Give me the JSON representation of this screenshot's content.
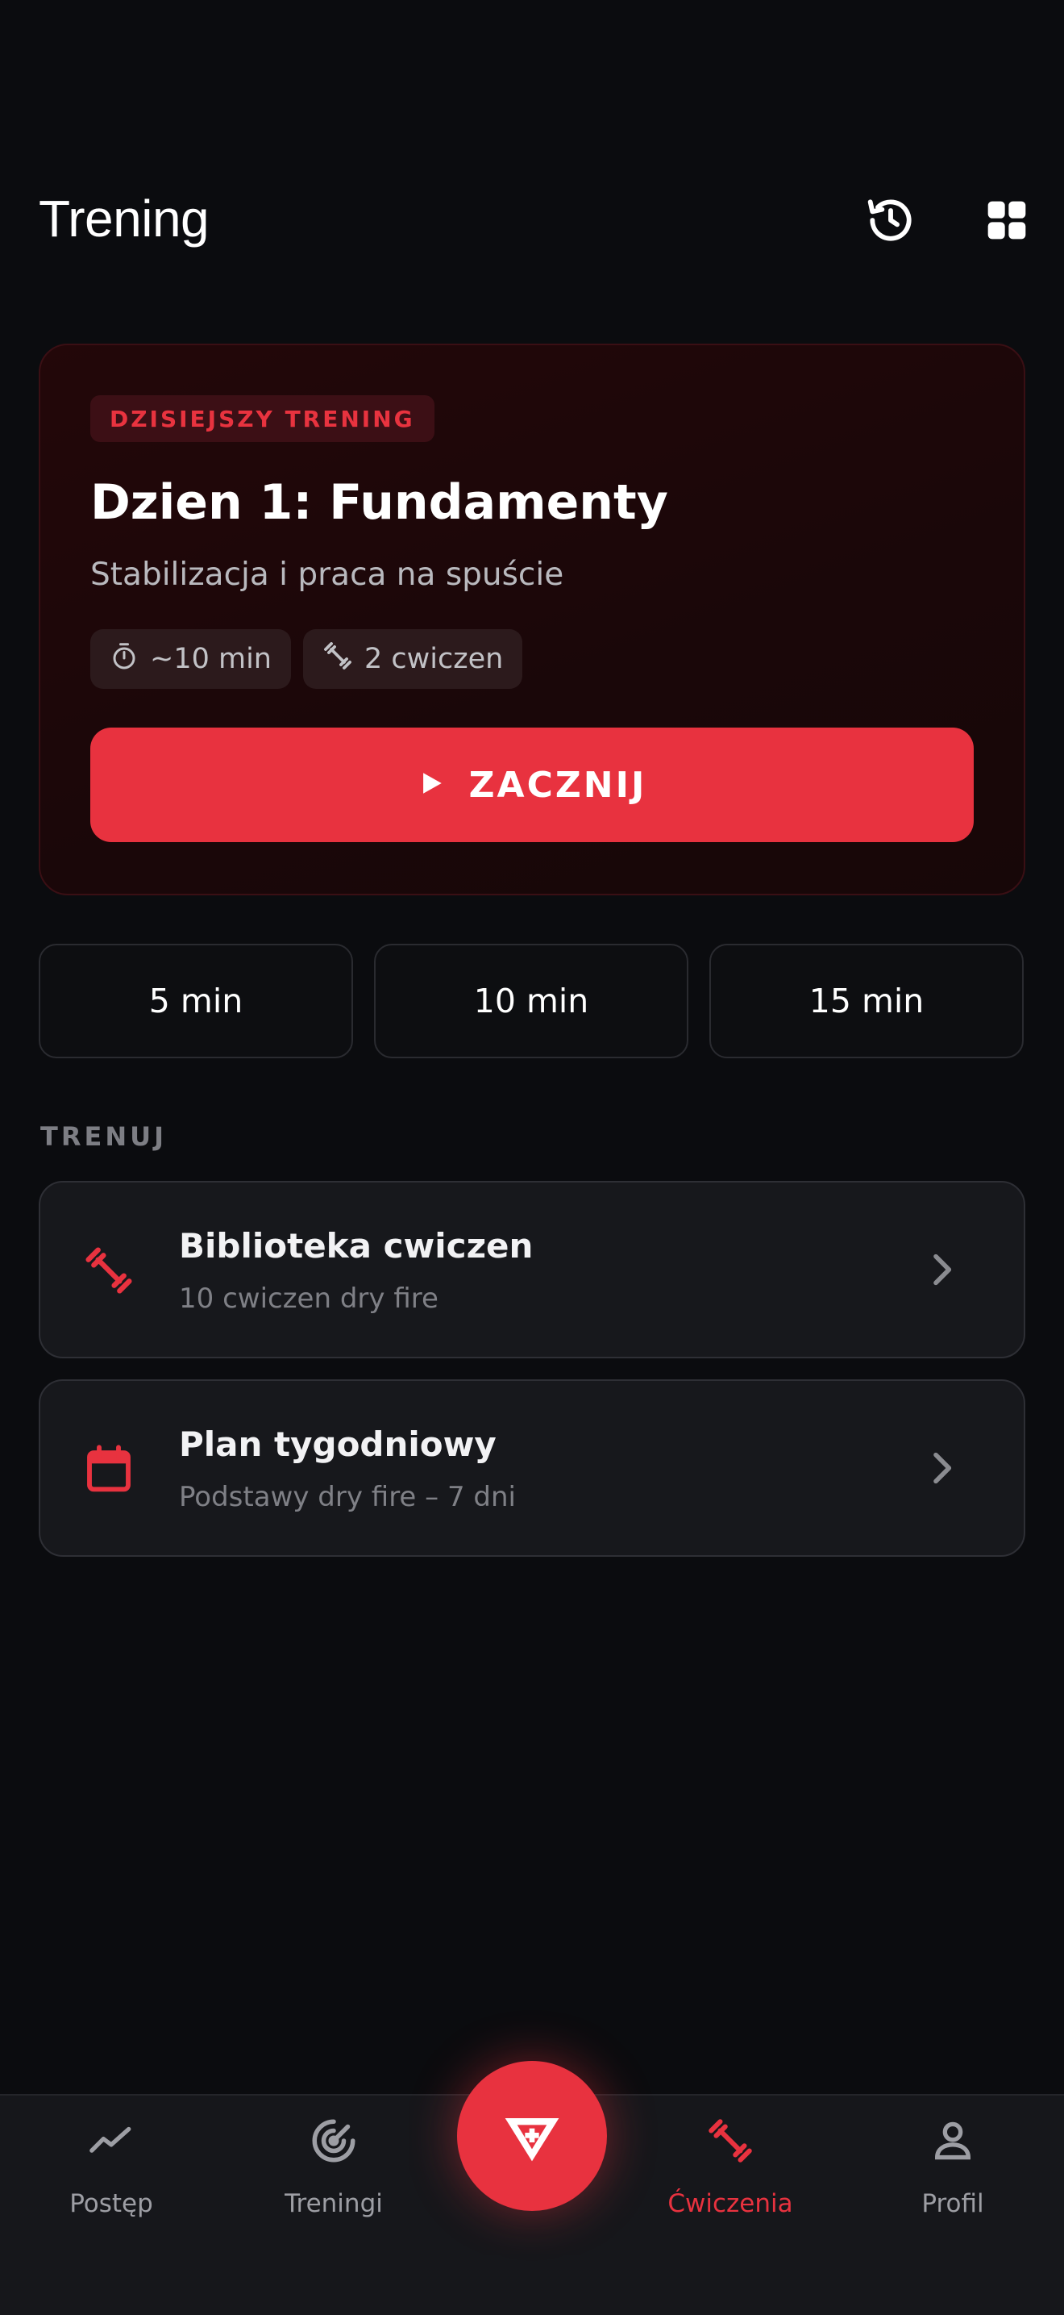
{
  "header": {
    "title": "Trening",
    "icons": [
      "history-icon",
      "grid-icon"
    ]
  },
  "today_card": {
    "tag": "DZISIEJSZY TRENING",
    "title": "Dzien 1: Fundamenty",
    "subtitle": "Stabilizacja i praca na spuście",
    "duration": "~10 min",
    "exercises": "2 cwiczen",
    "start_label": "ZACZNIJ"
  },
  "durations": [
    "5 min",
    "10 min",
    "15 min"
  ],
  "section_label": "TRENUJ",
  "items": [
    {
      "title": "Biblioteka cwiczen",
      "subtitle": "10 cwiczen dry fire",
      "icon": "dumbbell-icon"
    },
    {
      "title": "Plan tygodniowy",
      "subtitle": "Podstawy dry fire – 7 dni",
      "icon": "calendar-icon"
    }
  ],
  "nav": {
    "items": [
      {
        "label": "Postęp",
        "icon": "trend-icon"
      },
      {
        "label": "Treningi",
        "icon": "target-icon"
      },
      {
        "label": "Ćwiczenia",
        "icon": "dumbbell-icon",
        "active": true
      },
      {
        "label": "Profil",
        "icon": "person-icon"
      }
    ],
    "fab_icon": "logo-icon"
  },
  "colors": {
    "accent": "#e8323f",
    "background": "#0b0c0f",
    "card": "#17181c"
  }
}
